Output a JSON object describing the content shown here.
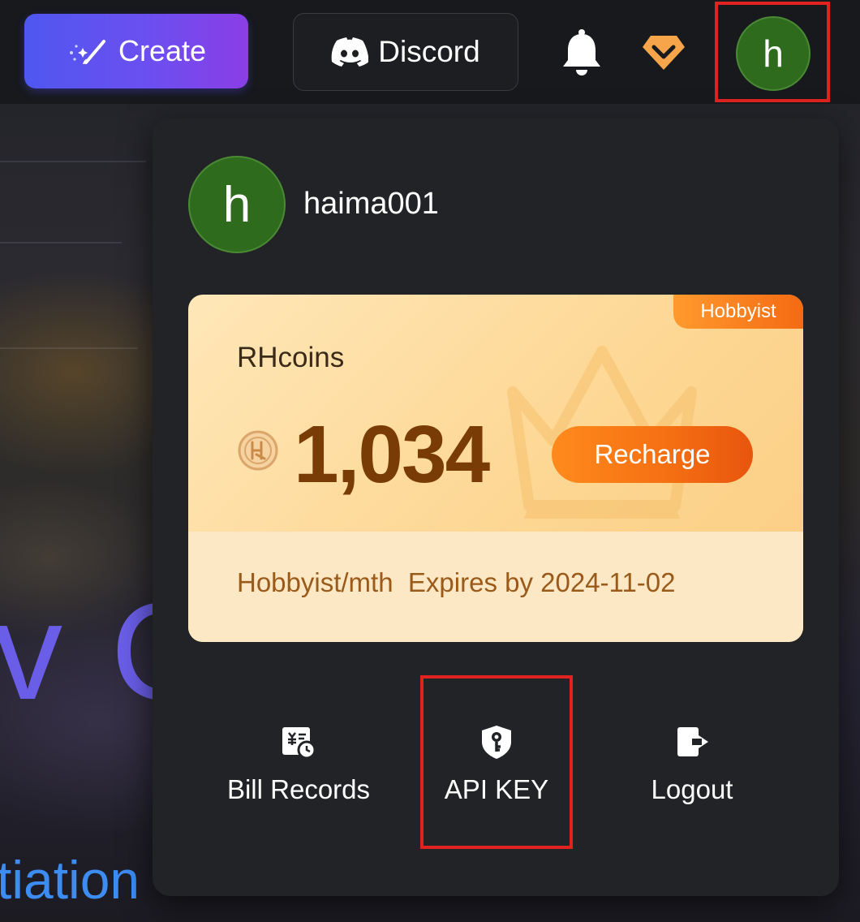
{
  "topbar": {
    "create_label": "Create",
    "discord_label": "Discord",
    "avatar_initial": "h",
    "icons": [
      "magic-wand-icon",
      "discord-icon",
      "bell-icon",
      "vip-diamond-icon"
    ]
  },
  "hero": {
    "big_text": "v C",
    "sub_text": "tiation"
  },
  "account_menu": {
    "avatar_initial": "h",
    "username": "haima001",
    "card": {
      "tier_badge": "Hobbyist",
      "coins_label": "RHcoins",
      "coin_amount": "1,034",
      "recharge_label": "Recharge",
      "plan_info": "Hobbyist/mth  Expires by 2024-11-02"
    },
    "actions": [
      {
        "label": "Bill Records",
        "icon": "bill-icon"
      },
      {
        "label": "API KEY",
        "icon": "key-shield-icon"
      },
      {
        "label": "Logout",
        "icon": "logout-icon"
      }
    ]
  },
  "colors": {
    "accent_purple": "#6b4ff0",
    "avatar_green": "#2e6b1d",
    "card_gold": "#fdd794",
    "recharge_orange": "#f46e12",
    "highlight_red": "#e0231f"
  }
}
